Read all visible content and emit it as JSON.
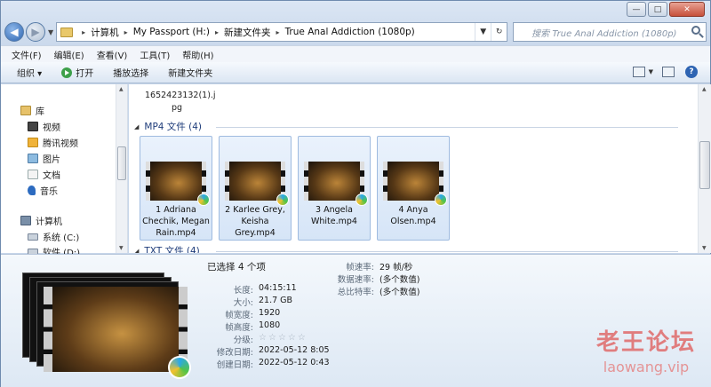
{
  "window": {
    "minimize_label": "—",
    "maximize_label": "□",
    "close_label": "✕"
  },
  "address": {
    "crumbs": [
      "计算机",
      "My Passport (H:)",
      "新建文件夹",
      "True Anal Addiction (1080p)"
    ],
    "refresh_icon": "refresh-icon"
  },
  "search": {
    "placeholder": "搜索 True Anal Addiction (1080p)"
  },
  "menu": [
    "文件(F)",
    "编辑(E)",
    "查看(V)",
    "工具(T)",
    "帮助(H)"
  ],
  "toolbar": {
    "organize": "组织 ▾",
    "open": "打开",
    "play_selection": "播放选择",
    "new_folder": "新建文件夹"
  },
  "nav": {
    "libraries": "库",
    "videos": "视频",
    "tencent_video": "腾讯视频",
    "pictures": "图片",
    "documents": "文档",
    "music": "音乐",
    "computer": "计算机",
    "system_c": "系统 (C:)",
    "software_d": "软件 (D:)"
  },
  "content": {
    "jpg_name_line1": "1652423132(1).j",
    "jpg_name_line2": "pg",
    "mp4_group": "MP4 文件 (4)",
    "txt_group": "TXT 文件 (4)",
    "files": [
      {
        "name": "1 Adriana Chechik, Megan Rain.mp4"
      },
      {
        "name": "2 Karlee Grey, Keisha Grey.mp4"
      },
      {
        "name": "3 Angela White.mp4"
      },
      {
        "name": "4 Anya Olsen.mp4"
      }
    ]
  },
  "details": {
    "selected": "已选择 4 个项",
    "length_k": "长度:",
    "length_v": "04:15:11",
    "size_k": "大小:",
    "size_v": "21.7 GB",
    "width_k": "帧宽度:",
    "width_v": "1920",
    "height_k": "帧高度:",
    "height_v": "1080",
    "rating_k": "分级:",
    "modified_k": "修改日期:",
    "modified_v": "2022-05-12 8:05",
    "created_k": "创建日期:",
    "created_v": "2022-05-12 0:43",
    "framerate_k": "帧速率:",
    "framerate_v": "29 帧/秒",
    "datarate_k": "数据速率:",
    "datarate_v": "(多个数值)",
    "bitrate_k": "总比特率:",
    "bitrate_v": "(多个数值)"
  },
  "watermark": {
    "cn": "老王论坛",
    "en": "laowang.vip"
  }
}
